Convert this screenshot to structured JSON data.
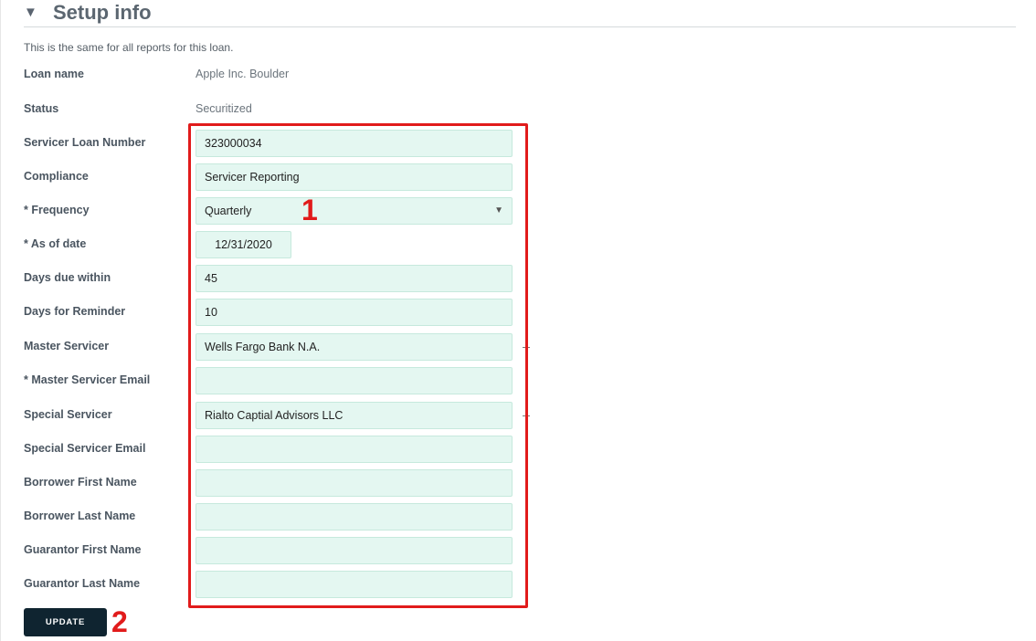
{
  "section": {
    "title": "Setup info",
    "subtitle": "This is the same for all reports for this loan."
  },
  "loan_name": {
    "label": "Loan name",
    "value": "Apple Inc. Boulder"
  },
  "status": {
    "label": "Status",
    "value": "Securitized"
  },
  "fields": {
    "servicer_loan_number": {
      "label": "Servicer Loan Number",
      "value": "323000034"
    },
    "compliance": {
      "label": "Compliance",
      "value": "Servicer Reporting"
    },
    "frequency": {
      "label": "* Frequency",
      "value": "Quarterly"
    },
    "as_of_date": {
      "label": "* As of date",
      "value": "12/31/2020"
    },
    "days_due_within": {
      "label": "Days due within",
      "value": "45"
    },
    "days_for_reminder": {
      "label": "Days for Reminder",
      "value": "10"
    },
    "master_servicer": {
      "label": "Master Servicer",
      "value": "Wells Fargo Bank N.A."
    },
    "master_servicer_email": {
      "label": "* Master Servicer Email",
      "value": ""
    },
    "special_servicer": {
      "label": "Special Servicer",
      "value": "Rialto Captial Advisors LLC"
    },
    "special_servicer_email": {
      "label": "Special Servicer Email",
      "value": ""
    },
    "borrower_first_name": {
      "label": "Borrower First Name",
      "value": ""
    },
    "borrower_last_name": {
      "label": "Borrower Last Name",
      "value": ""
    },
    "guarantor_first_name": {
      "label": "Guarantor First Name",
      "value": ""
    },
    "guarantor_last_name": {
      "label": "Guarantor Last Name",
      "value": ""
    }
  },
  "update_button": {
    "label": "UPDATE"
  },
  "annotations": {
    "box_number": "1",
    "button_number": "2"
  },
  "colors": {
    "field_bg": "#e4f7f1",
    "annotation_red": "#e11b1b",
    "button_bg": "#0f2430"
  },
  "icons": {
    "collapse": "triangle-down-icon",
    "dropdown": "chevron-down-icon"
  }
}
